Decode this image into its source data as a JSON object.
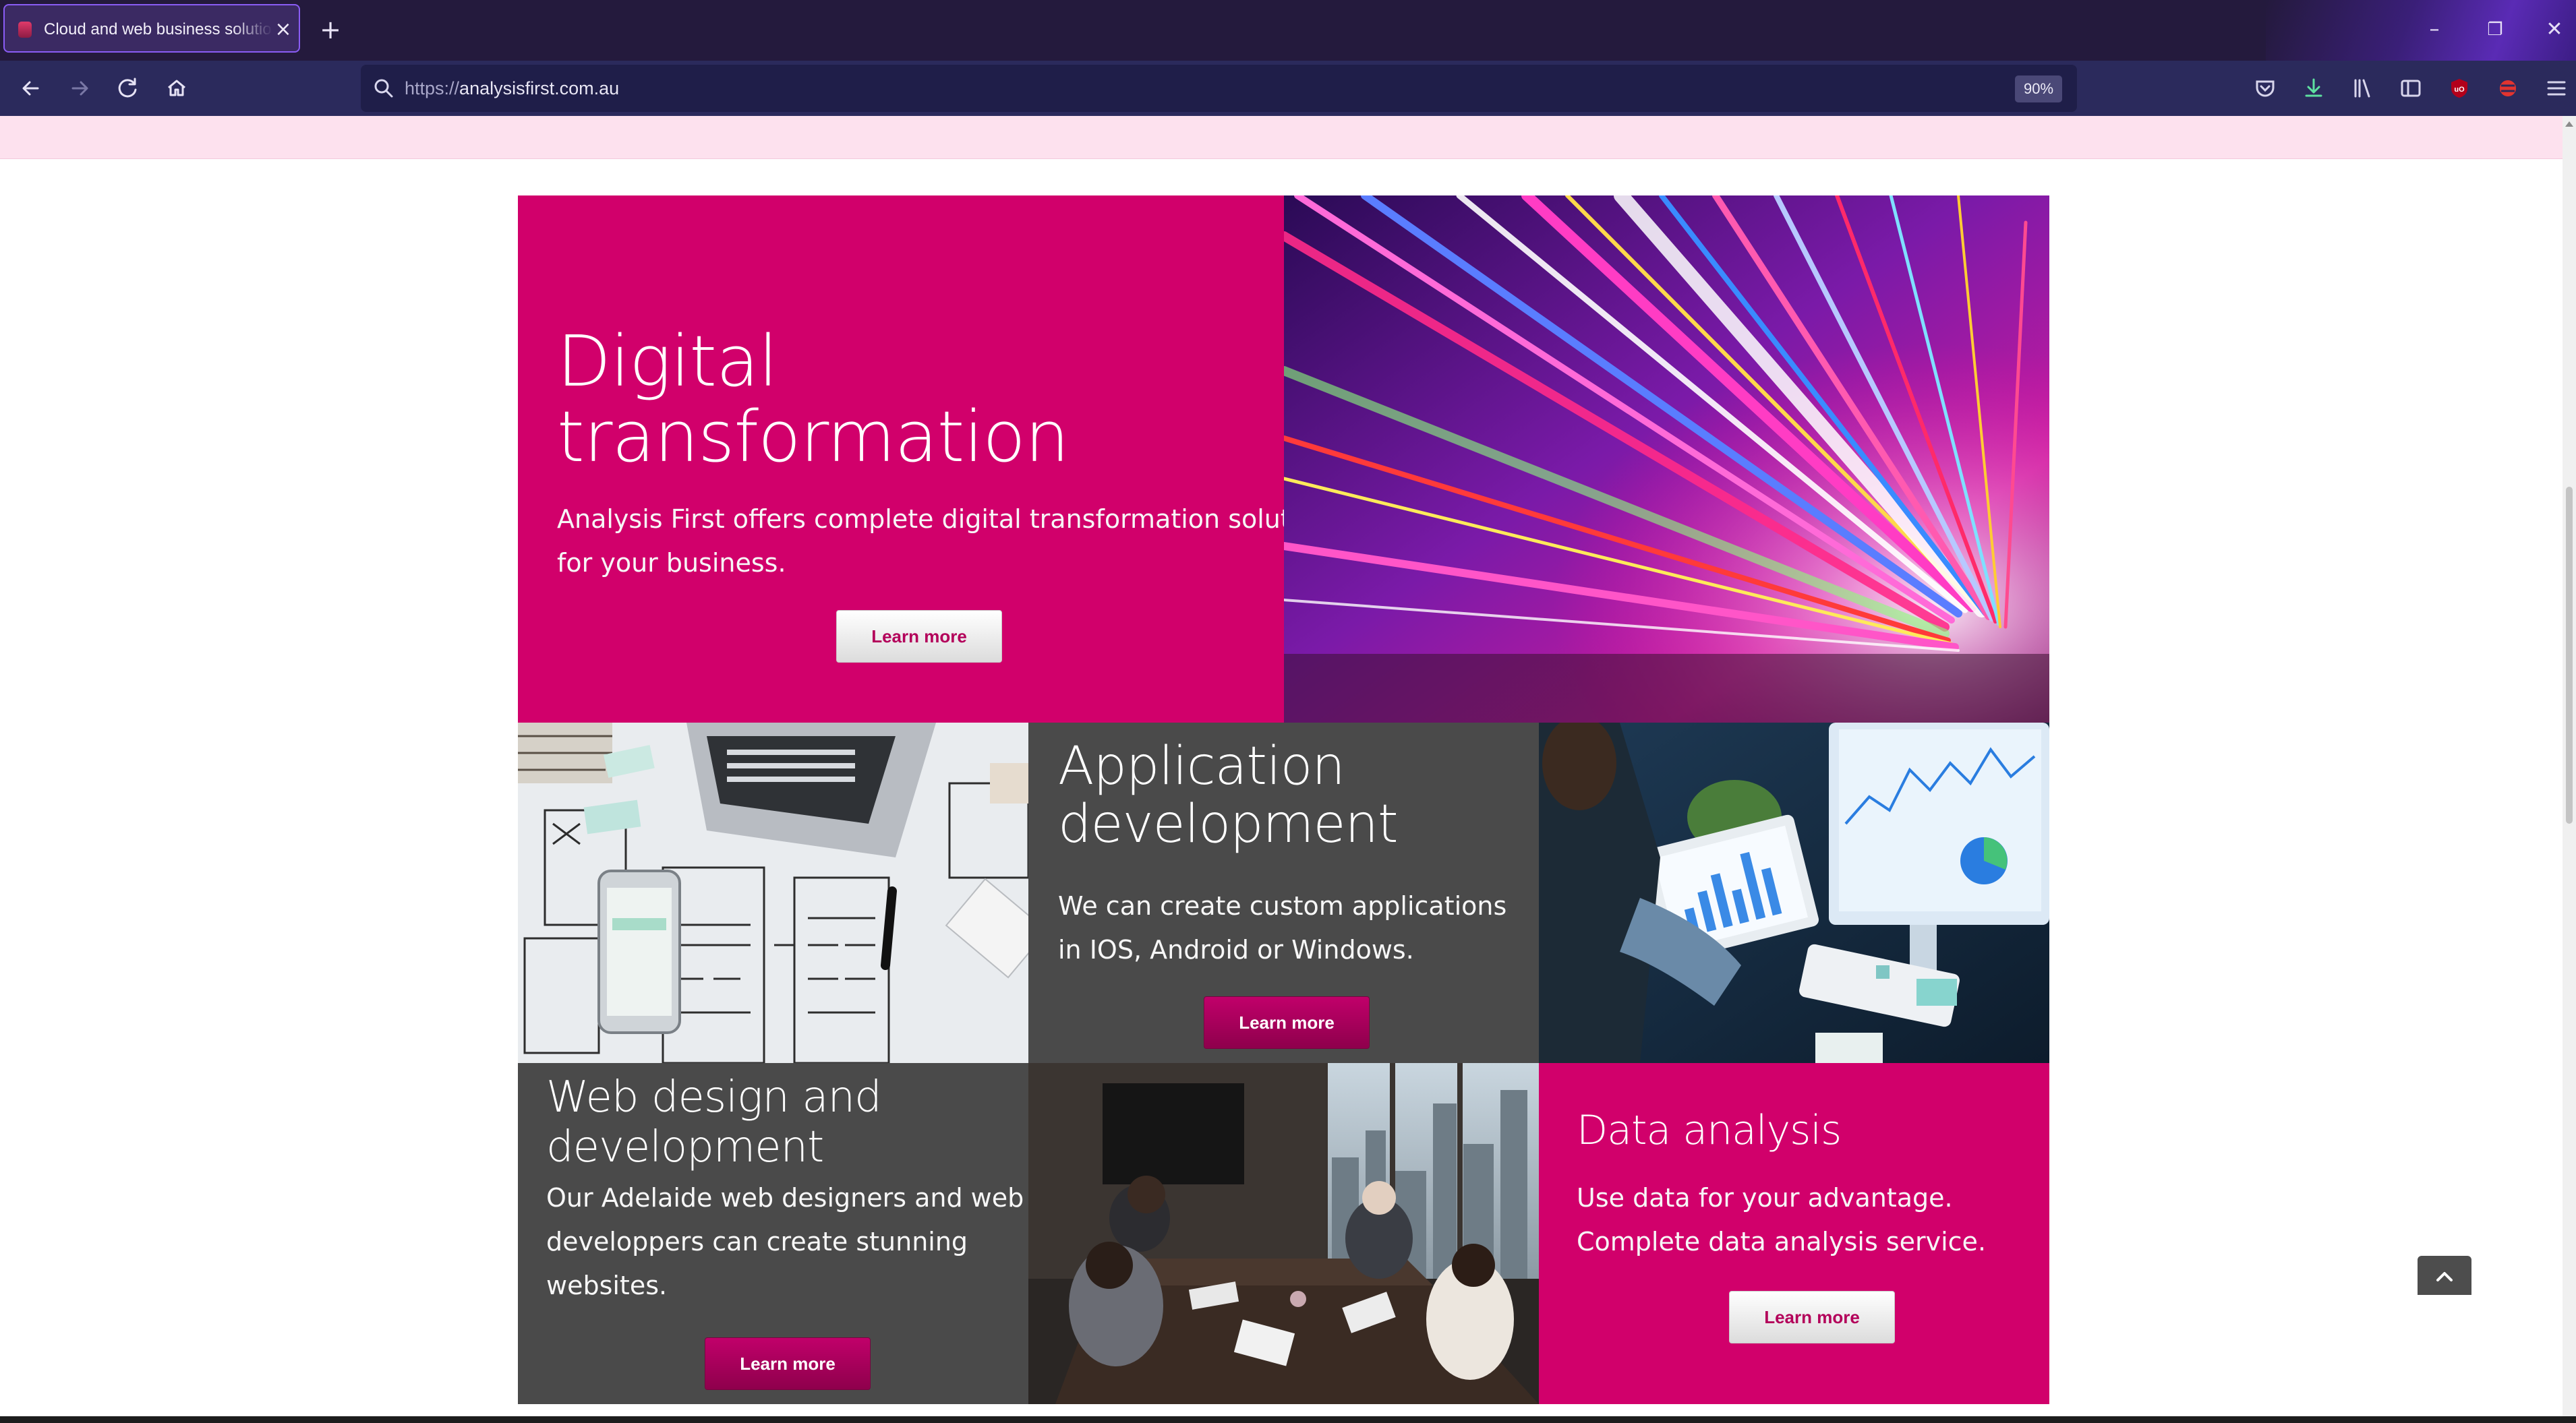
{
  "browser": {
    "tab_title": "Cloud and web business solutio",
    "tab_close": "×",
    "new_tab": "+",
    "url_protocol": "https://",
    "url_host": "analysisfirst.com.au",
    "zoom": "90%",
    "window_controls": {
      "minimize": "–",
      "restore": "❐",
      "close": "✕"
    },
    "nav_icons": [
      "back-icon",
      "forward-icon",
      "reload-icon",
      "home-icon"
    ],
    "toolbar_icons": [
      "pocket-icon",
      "downloads-icon",
      "library-icon",
      "sidebar-icon",
      "ublock-icon",
      "extension-icon",
      "menu-icon"
    ]
  },
  "hero": {
    "title_line1": "Digital",
    "title_line2": "transformation",
    "text_line1": "Analysis First offers complete digital transformation solution",
    "text_line2": "for your business.",
    "button": "Learn more",
    "image": "light-trails-photo"
  },
  "app_dev": {
    "title_line1": "Application",
    "title_line2": "development",
    "text_line1": "We can create custom applications",
    "text_line2": "in IOS, Android or Windows.",
    "button": "Learn more",
    "image_left": "wireframe-sketches-photo",
    "image_right": "analytics-dashboard-photo"
  },
  "web_design": {
    "title_line1": "Web design and",
    "title_line2": "development",
    "text_line1": "Our Adelaide web designers and web",
    "text_line2": "developpers can create stunning",
    "text_line3": "websites.",
    "button": "Learn more",
    "image": "meeting-room-photo"
  },
  "data_analysis": {
    "title": "Data analysis",
    "text_line1": "Use data for your advantage.",
    "text_line2": "Complete data analysis service.",
    "button": "Learn more"
  },
  "colors": {
    "magenta": "#d1006b",
    "dark_grey": "#4a4a4a",
    "chrome_bg": "#241a3d",
    "navbar_bg": "#2b2a5c",
    "pink_strip": "#fde1ee"
  }
}
